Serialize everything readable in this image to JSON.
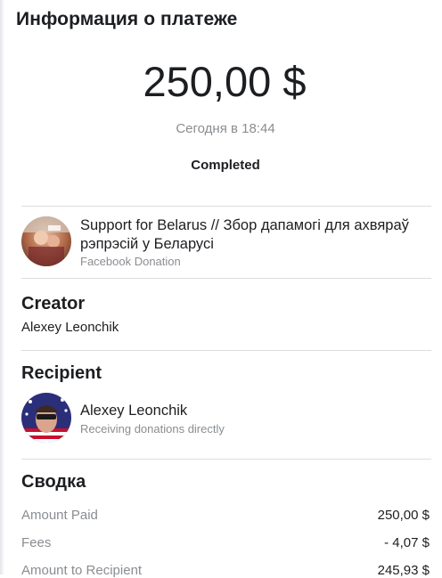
{
  "header": {
    "title": "Информация о платеже"
  },
  "payment": {
    "amount": "250,00 $",
    "date": "Сегодня в 18:44",
    "status": "Completed"
  },
  "fundraiser": {
    "title": "Support for Belarus // Збор дапамогі для ахвяраў рэпрэсій у Беларусі",
    "subtitle": "Facebook Donation"
  },
  "creator": {
    "heading": "Creator",
    "name": "Alexey Leonchik"
  },
  "recipient": {
    "heading": "Recipient",
    "name": "Alexey Leonchik",
    "subtitle": "Receiving donations directly"
  },
  "summary": {
    "heading": "Сводка",
    "rows": [
      {
        "label": "Amount Paid",
        "value": "250,00 $"
      },
      {
        "label": "Fees",
        "value": "- 4,07 $"
      },
      {
        "label": "Amount to Recipient",
        "value": "245,93 $"
      }
    ]
  },
  "icons": {
    "fundraiser_avatar": "fundraiser-photo-icon",
    "recipient_avatar": "recipient-photo-icon"
  }
}
